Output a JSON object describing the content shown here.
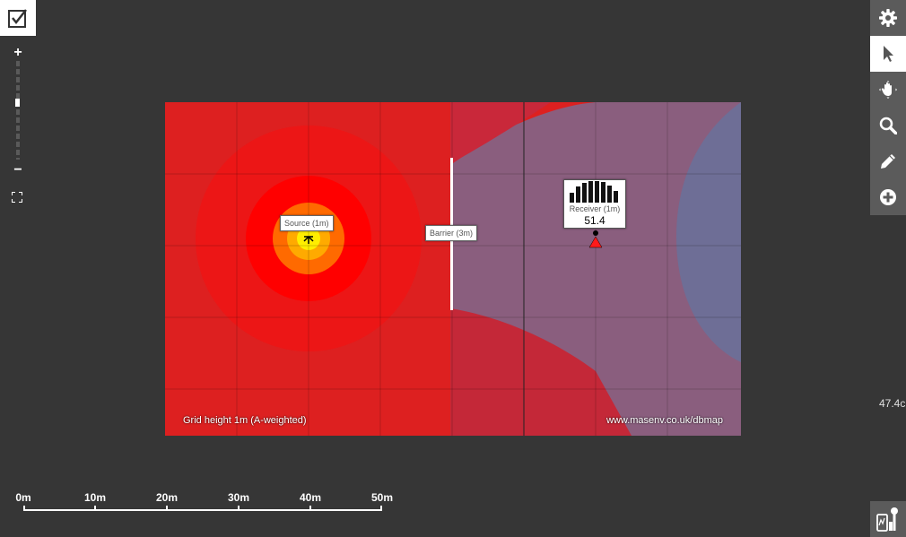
{
  "map": {
    "source_label": "Source (1m)",
    "barrier_label": "Barrier (3m)",
    "receiver": {
      "label": "Receiver (1m)",
      "value": "51.4",
      "spectrum_levels": [
        0.45,
        0.75,
        0.9,
        1.0,
        1.0,
        0.95,
        0.8,
        0.55
      ]
    },
    "grid_caption": "Grid height 1m (A-weighted)",
    "site_caption": "www.masenv.co.uk/dbmap",
    "colors": {
      "loud_red": "#e81c1c",
      "red": "#ff0000",
      "orange": "#ff6a00",
      "amber": "#ffaa00",
      "yellow": "#ffee00",
      "shadow_mauve": "#8a5e7e",
      "quiet_blue": "#6e6e96"
    }
  },
  "zoom": {
    "in_label": "+",
    "out_label": "−"
  },
  "toolbar": {
    "tools": [
      {
        "name": "settings",
        "icon": "gear-icon",
        "active": false
      },
      {
        "name": "select",
        "icon": "pointer-icon",
        "active": true
      },
      {
        "name": "pan",
        "icon": "hand-icon",
        "active": false
      },
      {
        "name": "zoom",
        "icon": "magnifier-icon",
        "active": false
      },
      {
        "name": "draw",
        "icon": "pencil-icon",
        "active": false
      },
      {
        "name": "add",
        "icon": "plus-circle-icon",
        "active": false
      }
    ]
  },
  "edge_value": "47.4c",
  "scale": {
    "labels": [
      "0m",
      "10m",
      "20m",
      "30m",
      "40m",
      "50m"
    ]
  }
}
